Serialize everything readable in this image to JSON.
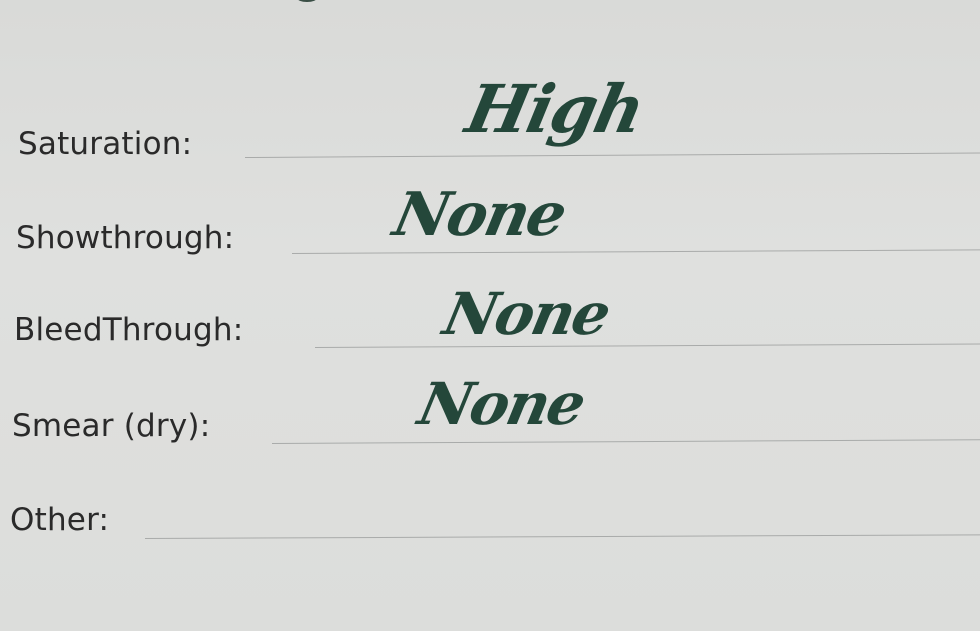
{
  "form": {
    "fields": [
      {
        "label": "Saturation:",
        "value": "High"
      },
      {
        "label": "Showthrough:",
        "value": "None"
      },
      {
        "label": "BleedThrough:",
        "value": "None"
      },
      {
        "label": "Smear (dry):",
        "value": "None"
      },
      {
        "label": "Other:",
        "value": ""
      }
    ]
  },
  "colors": {
    "ink": "#24473a",
    "paper": "#dcdddb",
    "print": "#2a2a2a"
  }
}
